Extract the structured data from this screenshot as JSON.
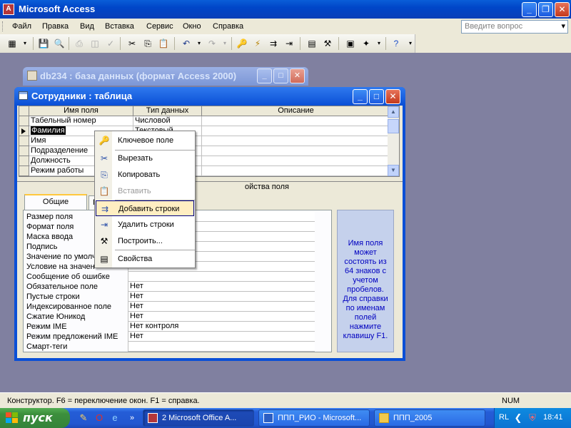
{
  "app": {
    "title": "Microsoft Access"
  },
  "menu": [
    "Файл",
    "Правка",
    "Вид",
    "Вставка",
    "Сервис",
    "Окно",
    "Справка"
  ],
  "help_search": {
    "placeholder": "Введите вопрос"
  },
  "db_window": {
    "title": "db234 : база данных (формат Access 2000)"
  },
  "table_window": {
    "title": "Сотрудники : таблица",
    "columns": [
      "Имя поля",
      "Тип данных",
      "Описание"
    ],
    "rows": [
      {
        "name": "Табельный номер",
        "type": "Числовой"
      },
      {
        "name": "Фамилия",
        "type": "Текстовый",
        "selected": true
      },
      {
        "name": "Имя",
        "type": ""
      },
      {
        "name": "Подразделение",
        "type": ""
      },
      {
        "name": "Должность",
        "type": ""
      },
      {
        "name": "Режим работы",
        "type": ""
      }
    ],
    "props_label": "ойства поля",
    "tabs": [
      "Общие",
      "П"
    ],
    "properties": [
      {
        "label": "Размер поля",
        "value": ""
      },
      {
        "label": "Формат поля",
        "value": ""
      },
      {
        "label": "Маска ввода",
        "value": ""
      },
      {
        "label": "Подпись",
        "value": ""
      },
      {
        "label": "Значение по умолч",
        "value": ""
      },
      {
        "label": "Условие на значен",
        "value": ""
      },
      {
        "label": "Сообщение об ошибке",
        "value": ""
      },
      {
        "label": "Обязательное поле",
        "value": "Нет"
      },
      {
        "label": "Пустые строки",
        "value": "Нет"
      },
      {
        "label": "Индексированное поле",
        "value": "Нет"
      },
      {
        "label": "Сжатие Юникод",
        "value": "Нет"
      },
      {
        "label": "Режим IME",
        "value": "Нет контроля"
      },
      {
        "label": "Режим предложений IME",
        "value": "Нет"
      },
      {
        "label": "Смарт-теги",
        "value": ""
      }
    ],
    "help_text": "Имя поля может состоять из 64 знаков с учетом пробелов. Для справки по именам полей нажмите клавишу F1."
  },
  "context_menu": [
    {
      "label": "Ключевое поле",
      "icon": "key-icon",
      "glyph": "🔑",
      "disabled": false
    },
    {
      "label": "Вырезать",
      "icon": "scissors-icon",
      "glyph": "✂",
      "disabled": false
    },
    {
      "label": "Копировать",
      "icon": "copy-icon",
      "glyph": "⎘",
      "disabled": false
    },
    {
      "label": "Вставить",
      "icon": "paste-icon",
      "glyph": "📋",
      "disabled": true
    },
    {
      "label": "Добавить строки",
      "icon": "insert-rows-icon",
      "glyph": "⇉",
      "disabled": false,
      "hover": true
    },
    {
      "label": "Удалить строки",
      "icon": "delete-rows-icon",
      "glyph": "⇥",
      "disabled": false
    },
    {
      "label": "Построить...",
      "icon": "build-icon",
      "glyph": "⚒",
      "disabled": false
    },
    {
      "label": "Свойства",
      "icon": "properties-icon",
      "glyph": "▤",
      "disabled": false
    }
  ],
  "status": {
    "text": "Конструктор.  F6 = переключение окон.  F1 = справка.",
    "num": "NUM"
  },
  "taskbar": {
    "start": "пуск",
    "tasks": [
      "2 Microsoft Office A...",
      "ППП_РИО - Microsoft...",
      "ППП_2005"
    ],
    "lang": "RL",
    "clock": "18:41"
  },
  "colors": {
    "accent": "#0a4fd6",
    "workspace": "#8080a0",
    "menu_hover": "#ffeec2"
  }
}
